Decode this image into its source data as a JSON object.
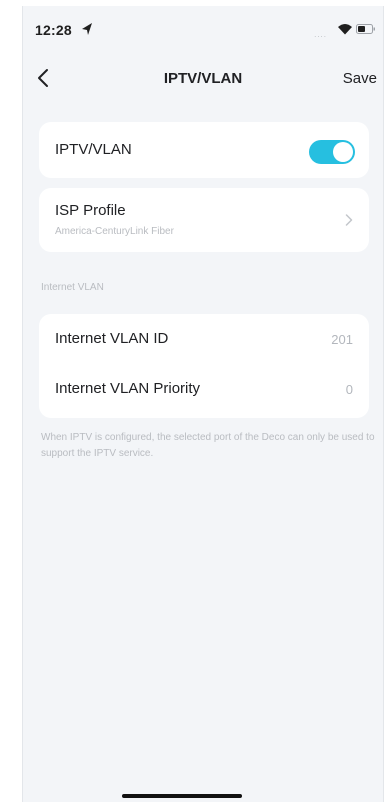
{
  "status_bar": {
    "time": "12:28",
    "signal_dots": "....",
    "icons": [
      "location-arrow-icon",
      "wifi-icon",
      "battery-icon"
    ]
  },
  "nav": {
    "back_icon": "chevron-left-icon",
    "title": "IPTV/VLAN",
    "save_label": "Save"
  },
  "iptv": {
    "label": "IPTV/VLAN",
    "enabled": true
  },
  "isp_profile": {
    "label": "ISP Profile",
    "value": "America-CenturyLink Fiber",
    "icon": "chevron-right-icon"
  },
  "internet_vlan": {
    "section_title": "Internet VLAN",
    "rows": [
      {
        "label": "Internet VLAN ID",
        "value": "201"
      },
      {
        "label": "Internet VLAN Priority",
        "value": "0"
      }
    ]
  },
  "footnote": "When IPTV is configured, the selected port of the Deco can only be used to support the IPTV service.",
  "colors": {
    "accent": "#26bfe0",
    "background": "#f3f5f8",
    "card": "#ffffff",
    "secondary_text": "#b9bcc1"
  }
}
